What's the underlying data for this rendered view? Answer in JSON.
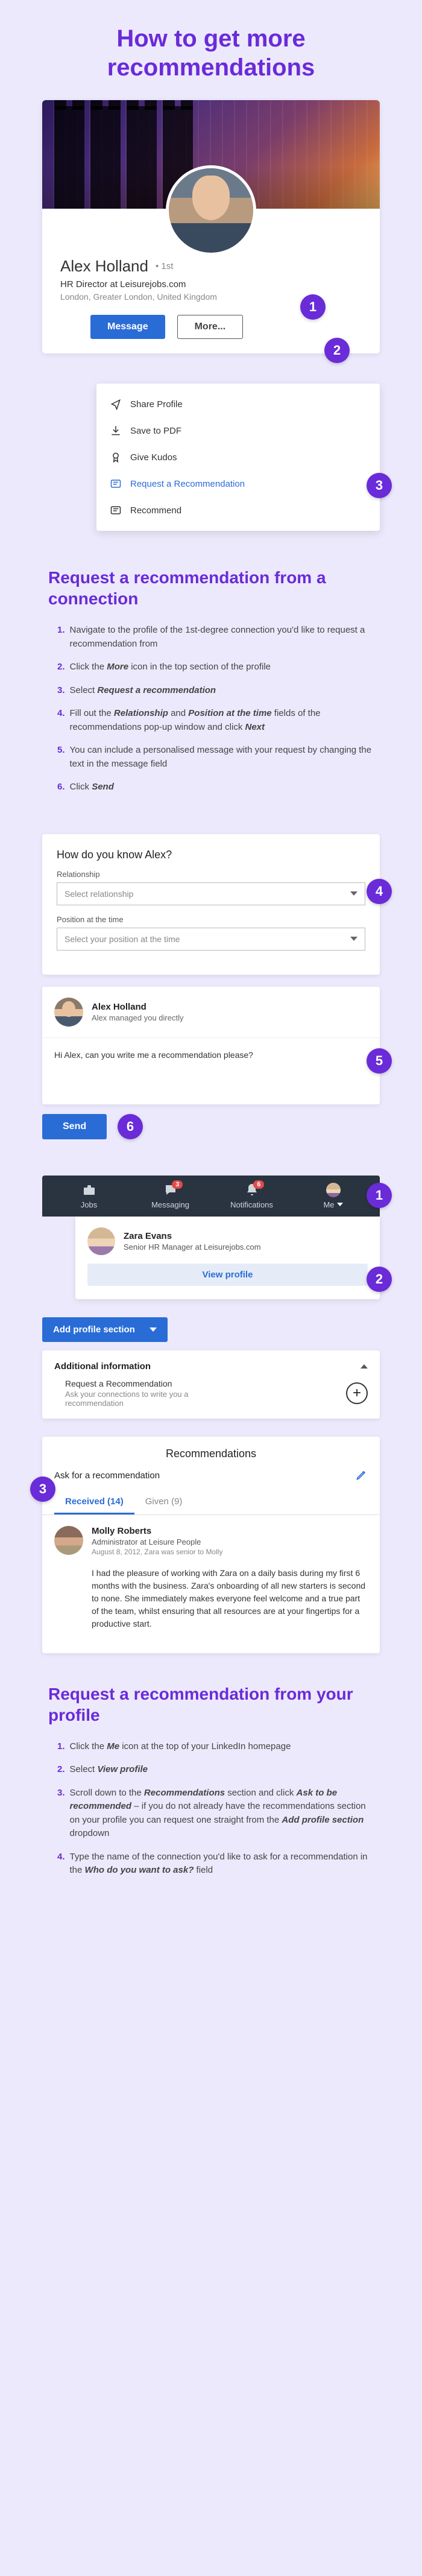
{
  "page_title": "How to get more recommendations",
  "profile": {
    "name": "Alex Holland",
    "degree": "• 1st",
    "headline": "HR Director at Leisurejobs.com",
    "location": "London, Greater London, United Kingdom",
    "btn_message": "Message",
    "btn_more": "More..."
  },
  "more_menu": {
    "share": "Share Profile",
    "pdf": "Save to PDF",
    "kudos": "Give Kudos",
    "request": "Request a Recommendation",
    "recommend": "Recommend"
  },
  "section1_title": "Request a recommendation from a connection",
  "steps1": {
    "s1": "Navigate to the profile of the 1st-degree connection you'd like to request a recommendation from",
    "s2a": "Click the ",
    "s2b": "More",
    "s2c": " icon in the top section of the profile",
    "s3a": "Select ",
    "s3b": "Request a recommendation",
    "s4a": "Fill out the ",
    "s4b": "Relationship",
    "s4c": " and ",
    "s4d": "Position at the time",
    "s4e": " fields of the recommendations pop-up window and click ",
    "s4f": "Next",
    "s5": "You can include a personalised message with your request by changing the text in the message field",
    "s6a": "Click ",
    "s6b": "Send"
  },
  "form": {
    "heading": "How do you know Alex?",
    "label_rel": "Relationship",
    "ph_rel": "Select relationship",
    "label_pos": "Position at the time",
    "ph_pos": "Select your position at the time"
  },
  "msg": {
    "name": "Alex Holland",
    "sub": "Alex managed you directly",
    "body": "Hi Alex, can you write me a recommendation please?",
    "send": "Send"
  },
  "nav": {
    "jobs": "Jobs",
    "messaging": "Messaging",
    "msg_count": "3",
    "notifications": "Notifications",
    "notif_count": "6",
    "me": "Me"
  },
  "me_drop": {
    "name": "Zara Evans",
    "title": "Senior HR Manager at Leisurejobs.com",
    "view": "View profile"
  },
  "add_section": "Add profile section",
  "addinfo": {
    "heading": "Additional information",
    "t": "Request a Recommendation",
    "s": "Ask your connections to write you a recommendation"
  },
  "recs": {
    "heading": "Recommendations",
    "ask": "Ask for a recommendation",
    "tab_received": "Received (14)",
    "tab_given": "Given (9)",
    "name": "Molly Roberts",
    "role": "Administrator at Leisure People",
    "date": "August 8, 2012, Zara was senior to Molly",
    "body": "I had the pleasure of working with Zara on a daily basis during my first 6 months with the business. Zara's onboarding of all new starters is second to none.\nShe immediately makes everyone feel welcome and a true part of the team, whilst ensuring that all resources are at your fingertips for a productive start."
  },
  "section2_title": "Request a recommendation from your profile",
  "steps2": {
    "s1a": "Click the ",
    "s1b": "Me",
    "s1c": " icon at the top of your LinkedIn homepage",
    "s2a": "Select ",
    "s2b": "View profile",
    "s3a": "Scroll down to the ",
    "s3b": "Recommendations",
    "s3c": " section and click ",
    "s3d": "Ask to be recommended",
    "s3e": " – if you do not already have the recommendations section on your profile you can request one straight from the ",
    "s3f": "Add profile section",
    "s3g": " dropdown",
    "s4a": "Type the name of the connection you'd like to ask for a recommendation in the ",
    "s4b": "Who do you want to ask?",
    "s4c": " field"
  },
  "badges": {
    "b1": "1",
    "b2": "2",
    "b3": "3",
    "b4": "4",
    "b5": "5",
    "b6": "6"
  }
}
